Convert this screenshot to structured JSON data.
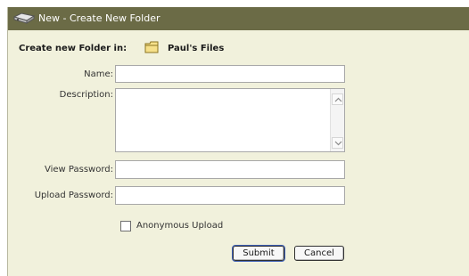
{
  "dialog": {
    "title": "New - Create New Folder",
    "heading_label": "Create new Folder in:",
    "heading_target": "Paul's Files"
  },
  "form": {
    "name_label": "Name:",
    "description_label": "Description:",
    "view_password_label": "View Password:",
    "upload_password_label": "Upload Password:",
    "name_value": "",
    "description_value": "",
    "view_password_value": "",
    "upload_password_value": "",
    "anonymous_upload_label": "Anonymous Upload",
    "anonymous_upload_checked": false
  },
  "buttons": {
    "submit": "Submit",
    "cancel": "Cancel"
  },
  "icons": {
    "title": "drive-icon",
    "folder": "folder-icon",
    "scroll_up": "chevron-up-icon",
    "scroll_down": "chevron-down-icon"
  },
  "colors": {
    "titlebar": "#6b6b46",
    "panel": "#f1f1dc",
    "submit_focus": "#3d5fb6"
  }
}
